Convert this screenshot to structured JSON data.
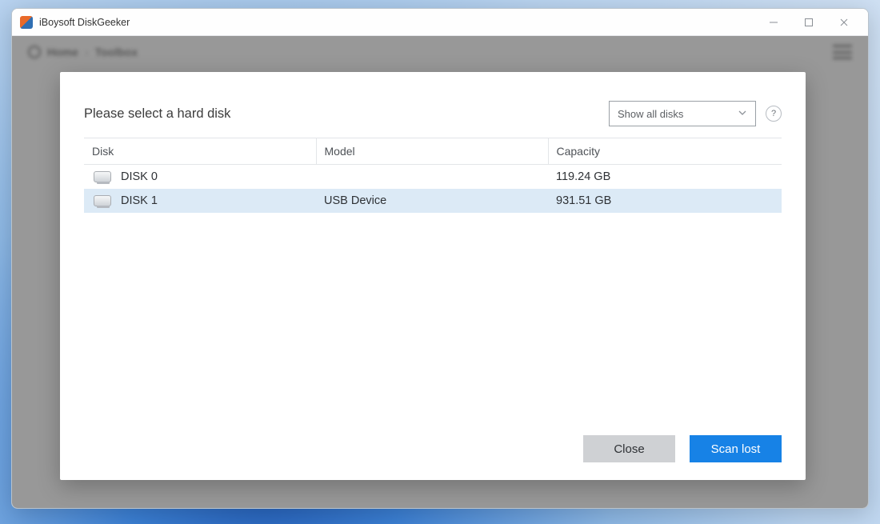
{
  "window": {
    "title": "iBoysoft DiskGeeker"
  },
  "breadcrumb": {
    "home": "Home",
    "current": "Toolbox"
  },
  "dialog": {
    "title": "Please select a hard disk",
    "filter_selected": "Show all disks",
    "help_label": "?",
    "columns": {
      "disk": "Disk",
      "model": "Model",
      "capacity": "Capacity"
    },
    "rows": [
      {
        "name": "DISK 0",
        "model": "",
        "capacity": "119.24 GB",
        "selected": false
      },
      {
        "name": "DISK 1",
        "model": "USB Device",
        "capacity": "931.51 GB",
        "selected": true
      }
    ],
    "buttons": {
      "close": "Close",
      "scan": "Scan lost"
    }
  }
}
